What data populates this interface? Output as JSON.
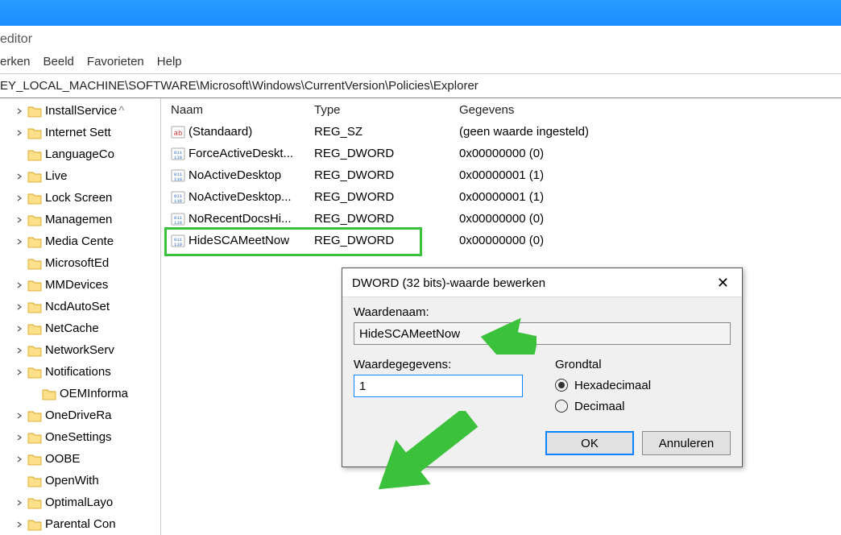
{
  "window": {
    "title": "editor"
  },
  "menubar": [
    "erken",
    "Beeld",
    "Favorieten",
    "Help"
  ],
  "addressbar": "EY_LOCAL_MACHINE\\SOFTWARE\\Microsoft\\Windows\\CurrentVersion\\Policies\\Explorer",
  "tree": [
    {
      "label": "InstallService",
      "caret": true,
      "scroll": true
    },
    {
      "label": "Internet Sett",
      "caret": true
    },
    {
      "label": "LanguageCo",
      "caret": false
    },
    {
      "label": "Live",
      "caret": true
    },
    {
      "label": "Lock Screen",
      "caret": true
    },
    {
      "label": "Managemen",
      "caret": true
    },
    {
      "label": "Media Cente",
      "caret": true
    },
    {
      "label": "MicrosoftEd",
      "caret": false
    },
    {
      "label": "MMDevices",
      "caret": true
    },
    {
      "label": "NcdAutoSet",
      "caret": true
    },
    {
      "label": "NetCache",
      "caret": true
    },
    {
      "label": "NetworkServ",
      "caret": true
    },
    {
      "label": "Notifications",
      "caret": true
    },
    {
      "label": "OEMInforma",
      "caret": false,
      "sub": true
    },
    {
      "label": "OneDriveRa",
      "caret": true
    },
    {
      "label": "OneSettings",
      "caret": true
    },
    {
      "label": "OOBE",
      "caret": true
    },
    {
      "label": "OpenWith",
      "caret": false
    },
    {
      "label": "OptimalLayo",
      "caret": true
    },
    {
      "label": "Parental Con",
      "caret": true
    }
  ],
  "list": {
    "headers": {
      "name": "Naam",
      "type": "Type",
      "data": "Gegevens"
    },
    "rows": [
      {
        "icon": "ab",
        "name": "(Standaard)",
        "type": "REG_SZ",
        "data": "(geen waarde ingesteld)"
      },
      {
        "icon": "dw",
        "name": "ForceActiveDeskt...",
        "type": "REG_DWORD",
        "data": "0x00000000 (0)"
      },
      {
        "icon": "dw",
        "name": "NoActiveDesktop",
        "type": "REG_DWORD",
        "data": "0x00000001 (1)"
      },
      {
        "icon": "dw",
        "name": "NoActiveDesktop...",
        "type": "REG_DWORD",
        "data": "0x00000001 (1)"
      },
      {
        "icon": "dw",
        "name": "NoRecentDocsHi...",
        "type": "REG_DWORD",
        "data": "0x00000000 (0)"
      },
      {
        "icon": "dw",
        "name": "HideSCAMeetNow",
        "type": "REG_DWORD",
        "data": "0x00000000 (0)"
      }
    ]
  },
  "dialog": {
    "title": "DWORD (32 bits)-waarde bewerken",
    "name_label": "Waardenaam:",
    "name_value": "HideSCAMeetNow",
    "data_label": "Waardegegevens:",
    "data_value": "1",
    "base_label": "Grondtal",
    "radio_hex": "Hexadecimaal",
    "radio_dec": "Decimaal",
    "ok": "OK",
    "cancel": "Annuleren"
  }
}
